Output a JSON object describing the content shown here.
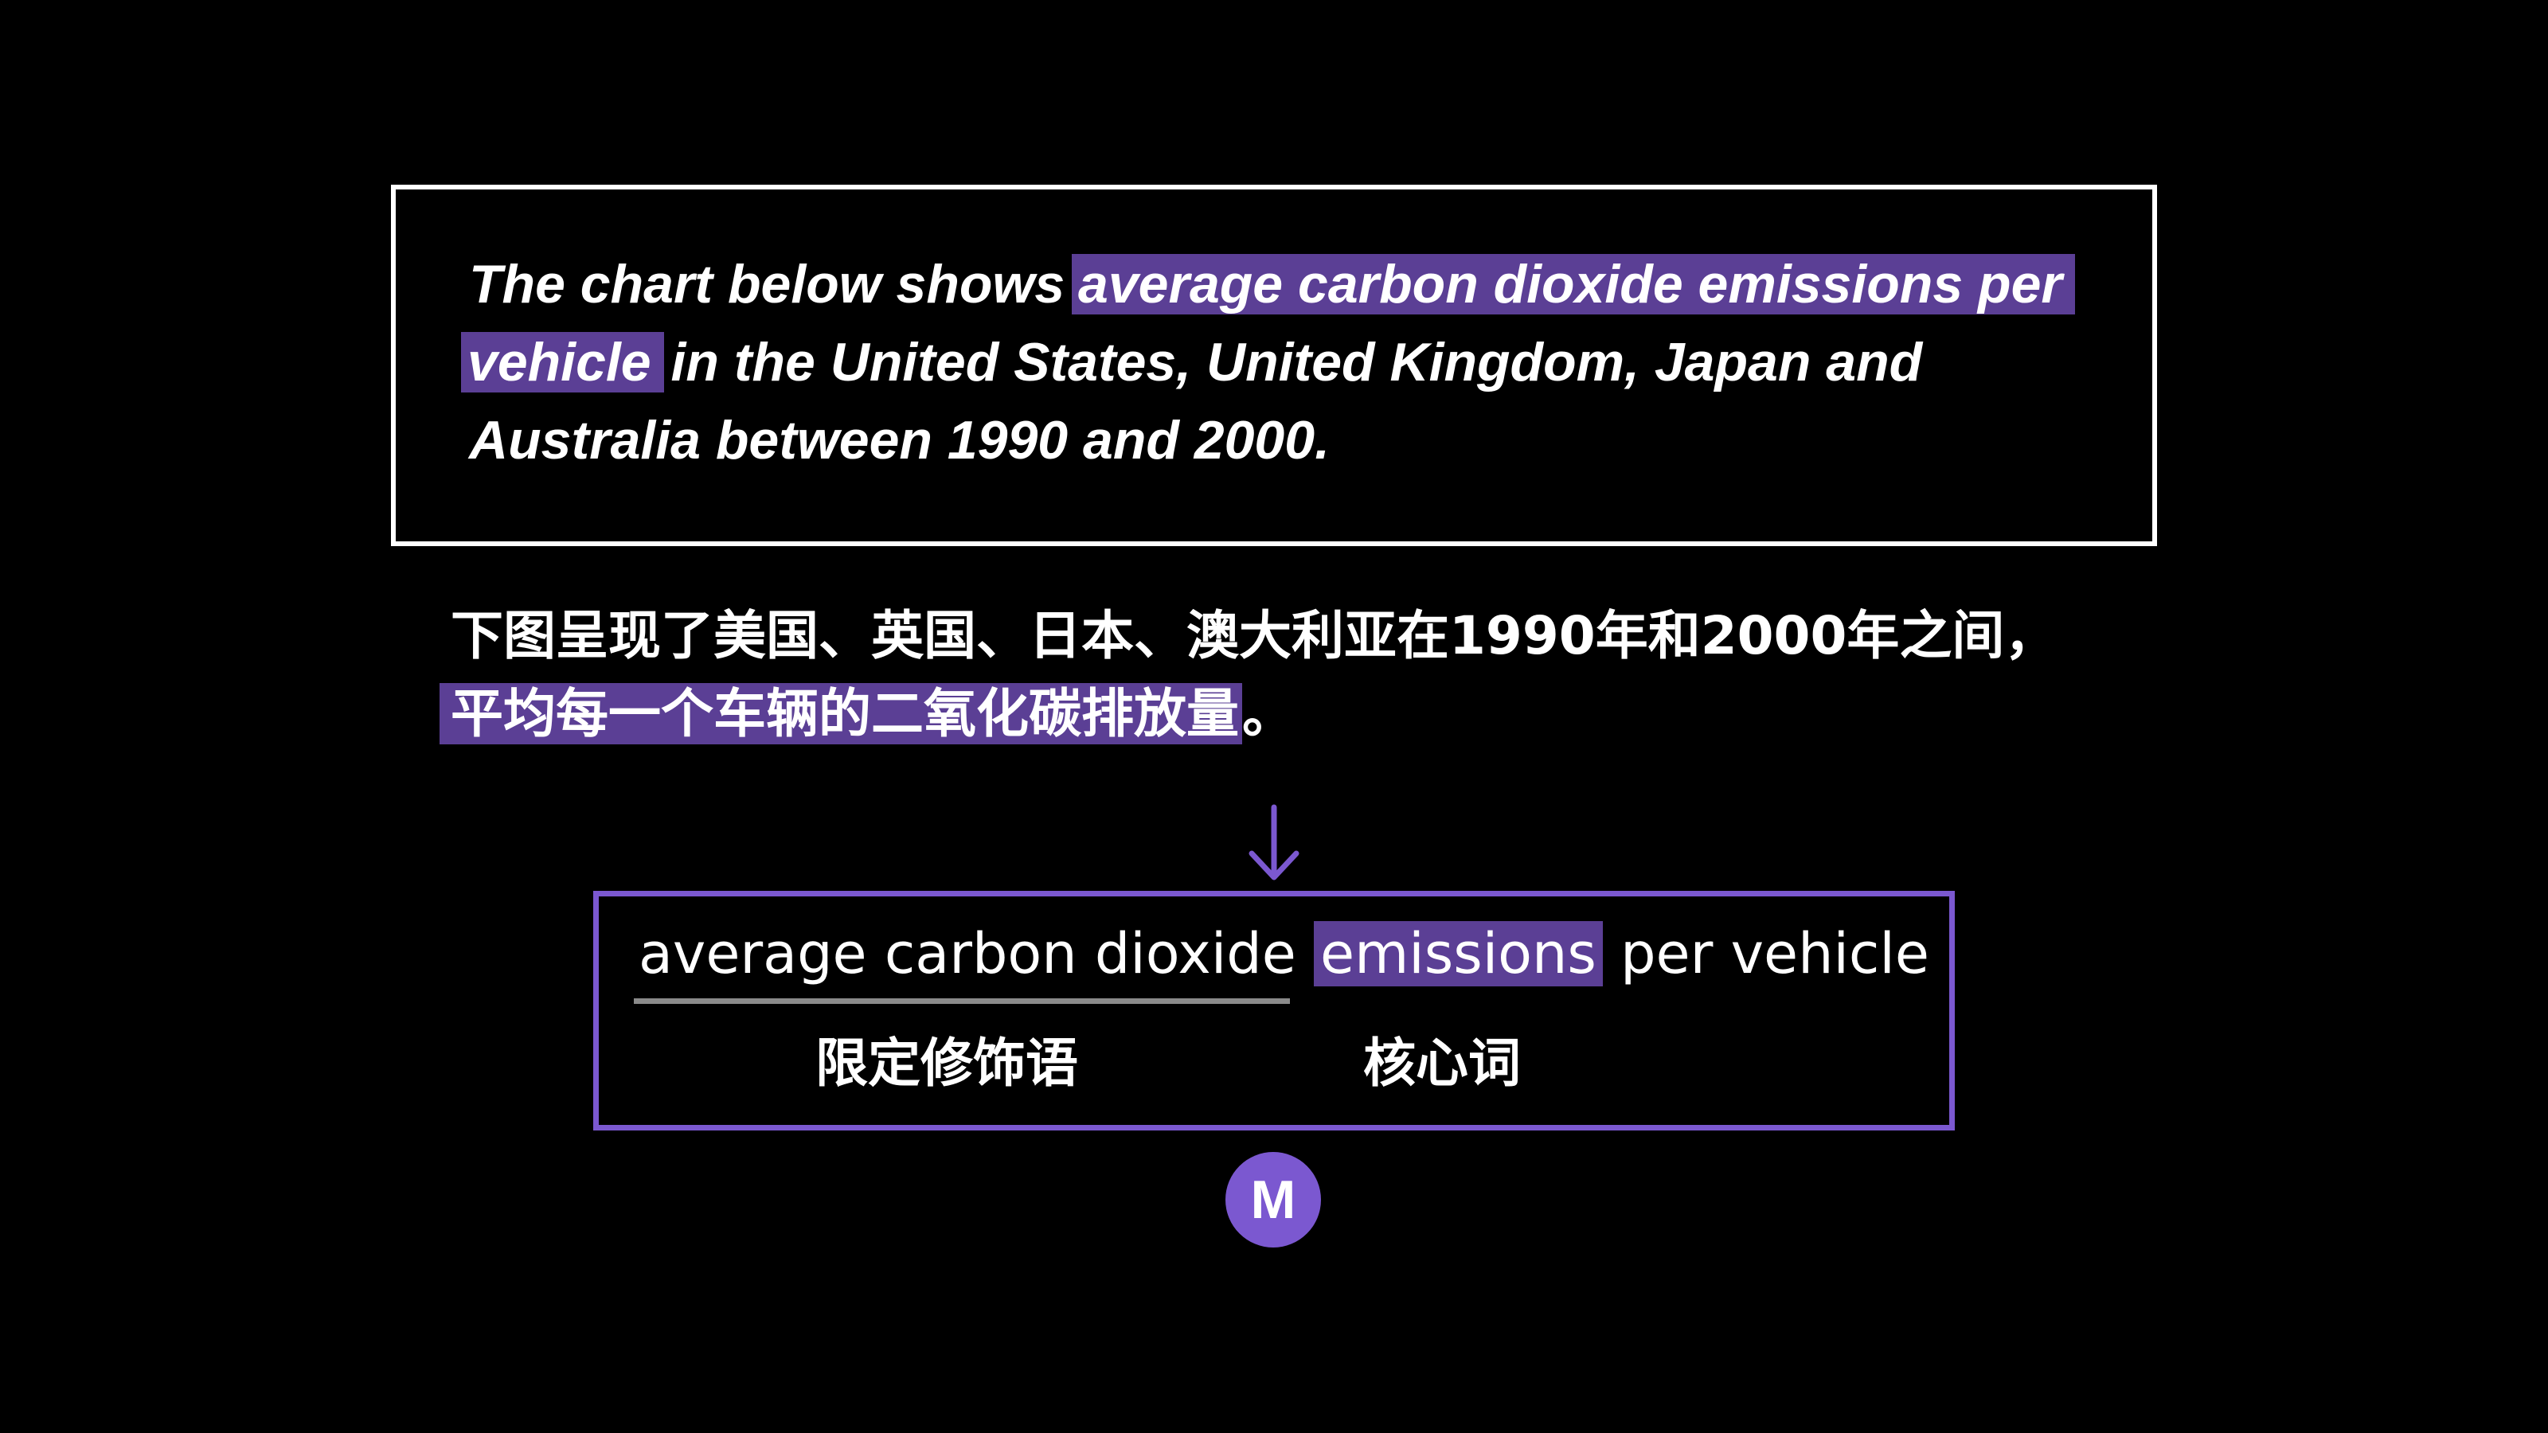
{
  "prompt": {
    "before": "The chart below shows ",
    "highlight": "average carbon dioxide emissions per vehicle",
    "after": " in the United States, United Kingdom, Japan and Australia between 1990 and 2000."
  },
  "translation": {
    "line1": "下图呈现了美国、英国、日本、澳大利亚在1990年和2000年之间，",
    "highlight": "平均每一个车辆的二氧化碳排放量",
    "end": "。"
  },
  "arrow": {
    "icon": "down-arrow-icon",
    "color": "#7b58d0"
  },
  "phrase": {
    "modifier": "average carbon dioxide",
    "head": "emissions",
    "tail": "per vehicle"
  },
  "labels": {
    "modifier": "限定修饰语",
    "head": "核心词"
  },
  "logo": {
    "letter": "M"
  },
  "colors": {
    "background": "#000000",
    "highlight": "#5b3f95",
    "accent": "#7b58d0",
    "underline": "#8a8a8a"
  }
}
